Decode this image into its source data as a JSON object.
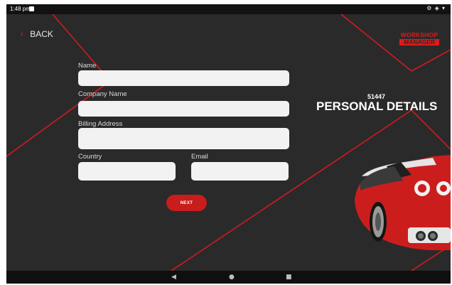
{
  "status": {
    "time": "1:48 pm",
    "icons": "⚙ ◈ ▾"
  },
  "header": {
    "back_label": "BACK"
  },
  "brand": {
    "line1": "WORKSHOP",
    "line2": "MANAGER"
  },
  "page": {
    "code": "51447",
    "title": "PERSONAL DETAILS"
  },
  "form": {
    "name_label": "Name",
    "name_value": "",
    "company_label": "Company Name",
    "company_value": "",
    "billing_label": "Billing Address",
    "billing_value": "",
    "country_label": "Country",
    "country_value": "",
    "email_label": "Email",
    "email_value": "",
    "next_label": "NEXT"
  },
  "nav": {
    "back_glyph": "◀",
    "home_glyph": "●",
    "recents_glyph": "■"
  },
  "colors": {
    "accent": "#c91c1c",
    "background": "#2a2a2b"
  }
}
